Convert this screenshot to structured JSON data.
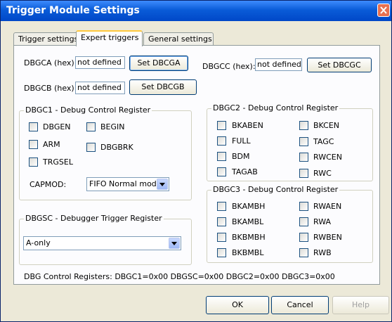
{
  "window": {
    "title": "Trigger Module Settings"
  },
  "tabs": [
    {
      "label": "Trigger settings"
    },
    {
      "label": "Expert triggers"
    },
    {
      "label": "General settings"
    }
  ],
  "dbgca": {
    "label": "DBGCA (hex):",
    "value": "not defined",
    "button": "Set DBCGA"
  },
  "dbgcb": {
    "label": "DBGCB (hex):",
    "value": "not defined",
    "button": "Set DBCGB"
  },
  "dbgcc": {
    "label": "DBGCC (hex):",
    "value": "not defined",
    "button": "Set DBCGC"
  },
  "dbgc1": {
    "legend": "DBGC1 - Debug Control Register",
    "checkboxes": [
      "DBGEN",
      "BEGIN",
      "ARM",
      "DBGBRK",
      "TRGSEL"
    ],
    "capmod_label": "CAPMOD:",
    "capmod_value": "FIFO Normal mode"
  },
  "dbgsc": {
    "legend": "DBGSC - Debugger Trigger Register",
    "value": "A-only"
  },
  "dbgc2": {
    "legend": "DBGC2 - Debug Control Register",
    "checkboxes": [
      "BKABEN",
      "BKCEN",
      "FULL",
      "TAGC",
      "BDM",
      "RWCEN",
      "TAGAB",
      "RWC"
    ]
  },
  "dbgc3": {
    "legend": "DBGC3 - Debug Control Register",
    "checkboxes": [
      "BKAMBH",
      "RWAEN",
      "BKAMBL",
      "RWA",
      "BKBMBH",
      "RWBEN",
      "BKBMBL",
      "RWB"
    ]
  },
  "status_text": "DBG Control Registers: DBGC1=0x00 DBGSC=0x00 DBGC2=0x00 DBGC3=0x00",
  "buttons": {
    "ok": "OK",
    "cancel": "Cancel",
    "help": "Help"
  }
}
